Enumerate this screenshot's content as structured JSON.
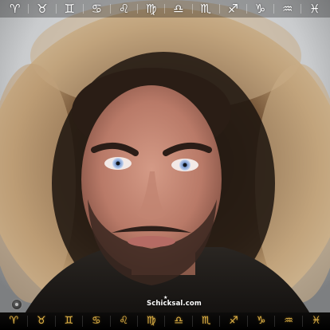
{
  "top_bar": {
    "signs": [
      {
        "name": "aries",
        "glyph": "♈︎"
      },
      {
        "name": "taurus",
        "glyph": "♉︎"
      },
      {
        "name": "gemini",
        "glyph": "♊︎"
      },
      {
        "name": "cancer",
        "glyph": "♋︎"
      },
      {
        "name": "leo",
        "glyph": "♌︎"
      },
      {
        "name": "virgo",
        "glyph": "♍︎"
      },
      {
        "name": "libra",
        "glyph": "♎︎"
      },
      {
        "name": "scorpio",
        "glyph": "♏︎"
      },
      {
        "name": "sagittarius",
        "glyph": "♐︎"
      },
      {
        "name": "capricorn",
        "glyph": "♑︎"
      },
      {
        "name": "aquarius",
        "glyph": "♒︎"
      },
      {
        "name": "pisces",
        "glyph": "♓︎"
      }
    ]
  },
  "brand": {
    "text": "Schicksal.com"
  },
  "bottom_bar": {
    "color": "#e2b64a",
    "signs": [
      {
        "name": "aries",
        "glyph": "♈︎"
      },
      {
        "name": "taurus",
        "glyph": "♉︎"
      },
      {
        "name": "gemini",
        "glyph": "♊︎"
      },
      {
        "name": "cancer",
        "glyph": "♋︎"
      },
      {
        "name": "leo",
        "glyph": "♌︎"
      },
      {
        "name": "virgo",
        "glyph": "♍︎"
      },
      {
        "name": "libra",
        "glyph": "♎︎"
      },
      {
        "name": "scorpio",
        "glyph": "♏︎"
      },
      {
        "name": "sagittarius",
        "glyph": "♐︎"
      },
      {
        "name": "capricorn",
        "glyph": "♑︎"
      },
      {
        "name": "aquarius",
        "glyph": "♒︎"
      },
      {
        "name": "pisces",
        "glyph": "♓︎"
      }
    ]
  }
}
